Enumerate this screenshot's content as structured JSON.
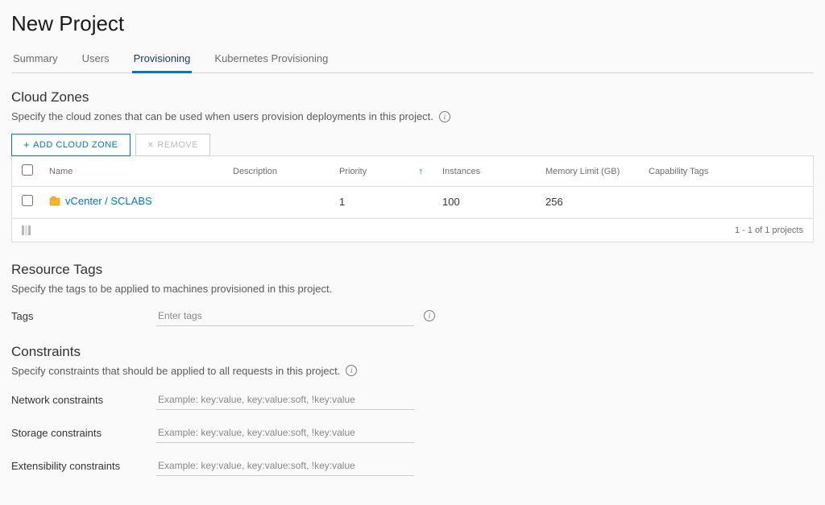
{
  "title": "New Project",
  "tabs": {
    "summary": "Summary",
    "users": "Users",
    "provisioning": "Provisioning",
    "kubernetes": "Kubernetes Provisioning"
  },
  "cloud_zones": {
    "heading": "Cloud Zones",
    "desc": "Specify the cloud zones that can be used when users provision deployments in this project.",
    "add_button": "ADD CLOUD ZONE",
    "remove_button": "REMOVE",
    "headers": {
      "name": "Name",
      "description": "Description",
      "priority": "Priority",
      "instances": "Instances",
      "memory": "Memory Limit (GB)",
      "capability": "Capability Tags"
    },
    "rows": [
      {
        "name": "vCenter / SCLABS",
        "description": "",
        "priority": "1",
        "instances": "100",
        "memory": "256",
        "capability": ""
      }
    ],
    "footer": "1 - 1 of 1 projects"
  },
  "resource_tags": {
    "heading": "Resource Tags",
    "desc": "Specify the tags to be applied to machines provisioned in this project.",
    "label": "Tags",
    "placeholder": "Enter tags"
  },
  "constraints": {
    "heading": "Constraints",
    "desc": "Specify constraints that should be applied to all requests in this project.",
    "network_label": "Network constraints",
    "storage_label": "Storage constraints",
    "extensibility_label": "Extensibility constraints",
    "placeholder": "Example: key:value, key:value:soft, !key:value"
  }
}
